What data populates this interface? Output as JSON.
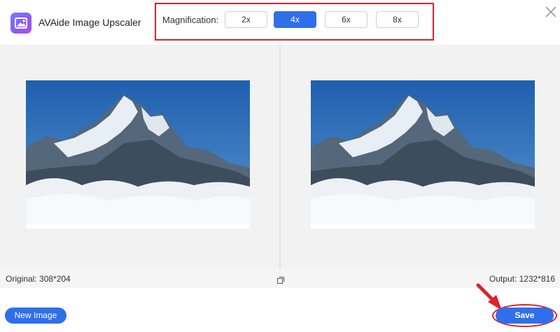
{
  "app": {
    "title": "AVAide Image Upscaler",
    "logo_icon": "image-upscaler-logo-icon",
    "close_icon": "close-icon"
  },
  "magnification": {
    "label": "Magnification:",
    "options": [
      "2x",
      "4x",
      "6x",
      "8x"
    ],
    "selected": "4x"
  },
  "preview": {
    "original_label": "Original: 308*204",
    "output_label": "Output: 1232*816",
    "compare_icon": "compare-icon"
  },
  "actions": {
    "new_image_label": "New Image",
    "save_label": "Save"
  },
  "colors": {
    "accent": "#2f6fea",
    "highlight": "#e0202a"
  }
}
